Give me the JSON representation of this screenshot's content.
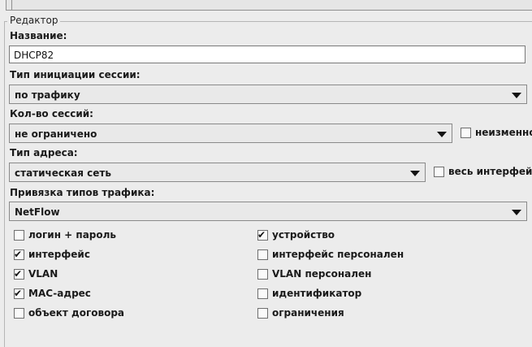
{
  "editor": {
    "legend": "Редактор",
    "name_label": "Название:",
    "name_value": "DHCP82",
    "session_init_label": "Тип инициации сессии:",
    "session_init_value": "по трафику",
    "session_count_label": "Кол-во сессий:",
    "session_count_value": "не ограничено",
    "session_count_fixed_label": "неизменно",
    "session_count_fixed_checked": false,
    "address_type_label": "Тип адреса:",
    "address_type_value": "статическая сеть",
    "whole_interface_label": "весь интерфейс",
    "whole_interface_checked": false,
    "traffic_binding_label": "Привязка типов трафика:",
    "traffic_binding_value": "NetFlow"
  },
  "options_left": [
    {
      "label": "логин + пароль",
      "checked": false
    },
    {
      "label": "интерфейс",
      "checked": true
    },
    {
      "label": "VLAN",
      "checked": true
    },
    {
      "label": "MAC-адрес",
      "checked": true
    },
    {
      "label": "объект договора",
      "checked": false
    }
  ],
  "options_right": [
    {
      "label": "устройство",
      "checked": true
    },
    {
      "label": "интерфейс персонален",
      "checked": false
    },
    {
      "label": "VLAN персонален",
      "checked": false
    },
    {
      "label": "идентификатор",
      "checked": false
    },
    {
      "label": "ограничения",
      "checked": false
    }
  ],
  "check_glyph": "✔"
}
